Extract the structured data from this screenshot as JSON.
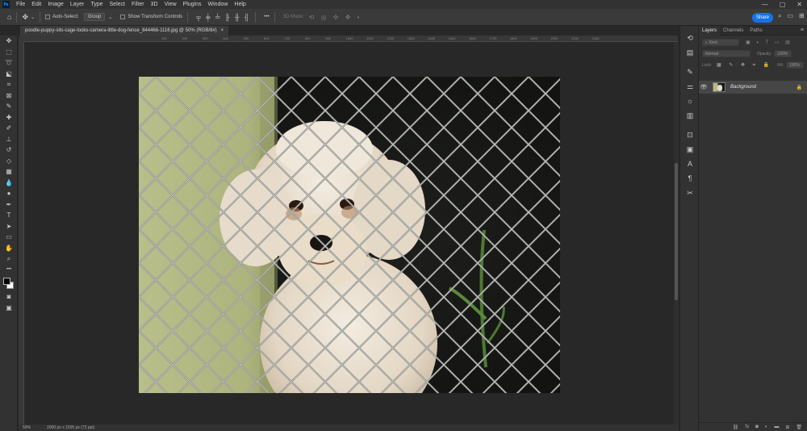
{
  "app": {
    "logo": "Ps"
  },
  "menu": [
    "File",
    "Edit",
    "Image",
    "Layer",
    "Type",
    "Select",
    "Filter",
    "3D",
    "View",
    "Plugins",
    "Window",
    "Help"
  ],
  "window_controls": {
    "minimize": "—",
    "restore": "▢",
    "close": "✕"
  },
  "options_bar": {
    "auto_select_label": "Auto-Select:",
    "auto_select_value": "Group",
    "show_transform_label": "Show Transform Controls",
    "more_label": "•••",
    "mode_3d_label": "3D Mode:"
  },
  "share": {
    "label": "Share"
  },
  "document": {
    "tab_title": "poodle-puppy-sits-cage-looks-camera-little-dog-fence_844466-1116.jpg @ 50% (RGB/8#)",
    "close": "×",
    "zoom": "50%",
    "info": "2000 px x 1505 px (72 ppi)"
  },
  "rulers": {
    "h_ticks": [
      "100",
      "200",
      "300",
      "400",
      "500",
      "600",
      "700",
      "800",
      "900",
      "1000",
      "1100",
      "1200",
      "1300",
      "1400",
      "1500",
      "1600",
      "1700",
      "1800",
      "1900",
      "2000",
      "2100",
      "2200"
    ]
  },
  "layers_panel": {
    "tabs": [
      "Layers",
      "Channels",
      "Paths"
    ],
    "kind_placeholder": "Kind",
    "blend_mode": "Normal",
    "opacity_label": "Opacity:",
    "opacity_value": "100%",
    "lock_label": "Lock:",
    "fill_label": "Fill:",
    "fill_value": "100%",
    "layers": [
      {
        "name": "Background",
        "visible": true,
        "locked": true
      }
    ]
  },
  "colors": {
    "accent": "#1473e6",
    "foreground": "#000000",
    "background": "#ffffff"
  }
}
